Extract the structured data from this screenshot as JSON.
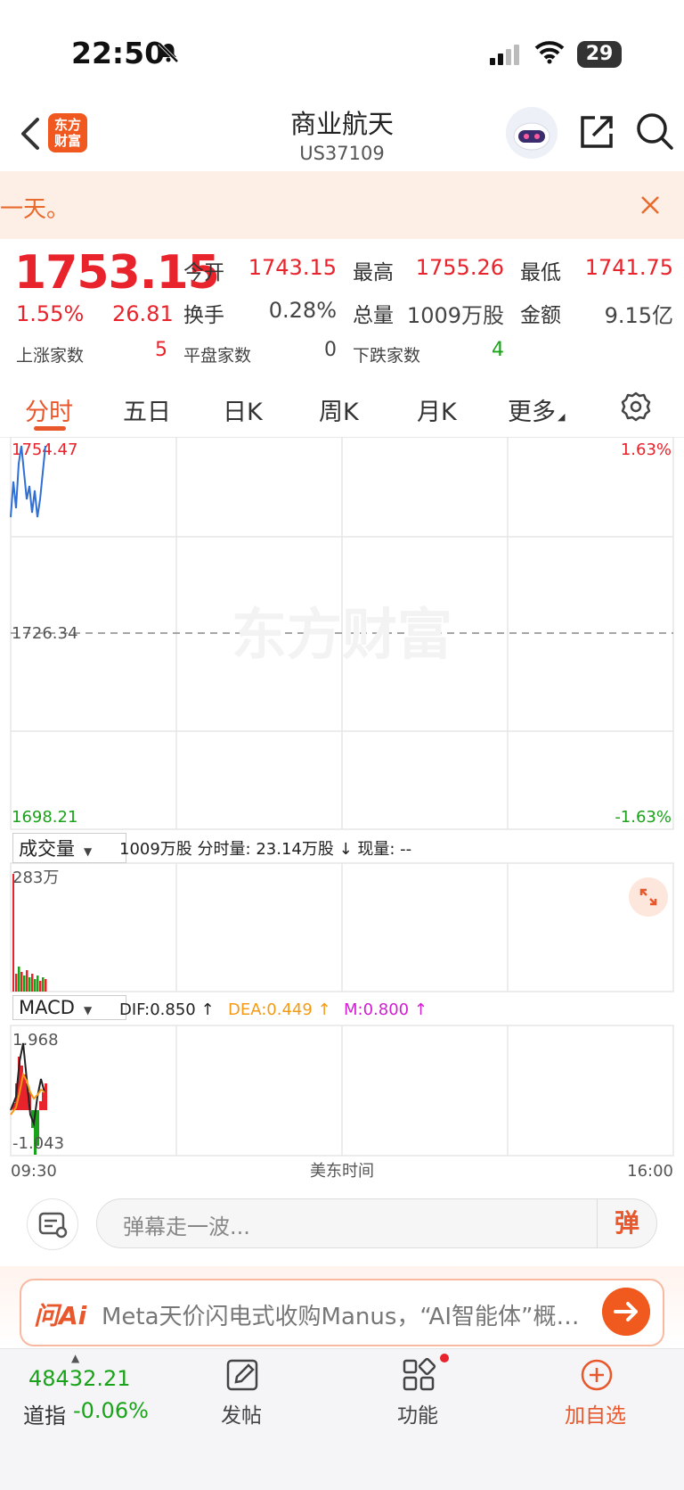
{
  "status_bar": {
    "time": "22:50",
    "battery": "29"
  },
  "header": {
    "title": "商业航天",
    "code": "US37109",
    "logo_text": "东方财富"
  },
  "banner": {
    "text": "一天。"
  },
  "quote": {
    "price": "1753.15",
    "change_pct": "1.55%",
    "change": "26.81",
    "open_label": "今开",
    "open": "1743.15",
    "high_label": "最高",
    "high": "1755.26",
    "low_label": "最低",
    "low": "1741.75",
    "turnover_label": "换手",
    "turnover": "0.28%",
    "volume_label": "总量",
    "volume": "1009万股",
    "amount_label": "金额",
    "amount": "9.15亿",
    "up_label": "上涨家数",
    "up": "5",
    "flat_label": "平盘家数",
    "flat": "0",
    "down_label": "下跌家数",
    "down": "4"
  },
  "tabs": [
    "分时",
    "五日",
    "日K",
    "周K",
    "月K",
    "更多"
  ],
  "chart": {
    "top_price": "1754.47",
    "top_pct": "1.63%",
    "mid_price": "1726.34",
    "bottom_price": "1698.21",
    "bottom_pct": "-1.63%",
    "watermark": "东方财富",
    "vol_selector": "成交量",
    "vol_info": "1009万股 分时量: 23.14万股 ↓ 现量: --",
    "vol_max": "283万",
    "macd_selector": "MACD",
    "dif": "DIF:0.850 ↑",
    "dea": "DEA:0.449 ↑",
    "m": "M:0.800 ↑",
    "macd_top": "1.968",
    "macd_bottom": "-1.043",
    "time_start": "09:30",
    "time_mid": "美东时间",
    "time_end": "16:00",
    "colors": {
      "line": "#2f6fd6",
      "up": "#e8232b",
      "down": "#1aa31a",
      "dea": "#f59a14",
      "m": "#d020d0"
    }
  },
  "comment": {
    "placeholder": "弹幕走一波...",
    "danmu_label": "弹"
  },
  "ai": {
    "logo": "问Ai",
    "text": "Meta天价闪电式收购Manus，“AI智能体”概…"
  },
  "nav": {
    "index_value": "48432.21",
    "index_name": "道指",
    "index_pct": "-0.06%",
    "post": "发帖",
    "functions": "功能",
    "add_watch": "加自选"
  }
}
